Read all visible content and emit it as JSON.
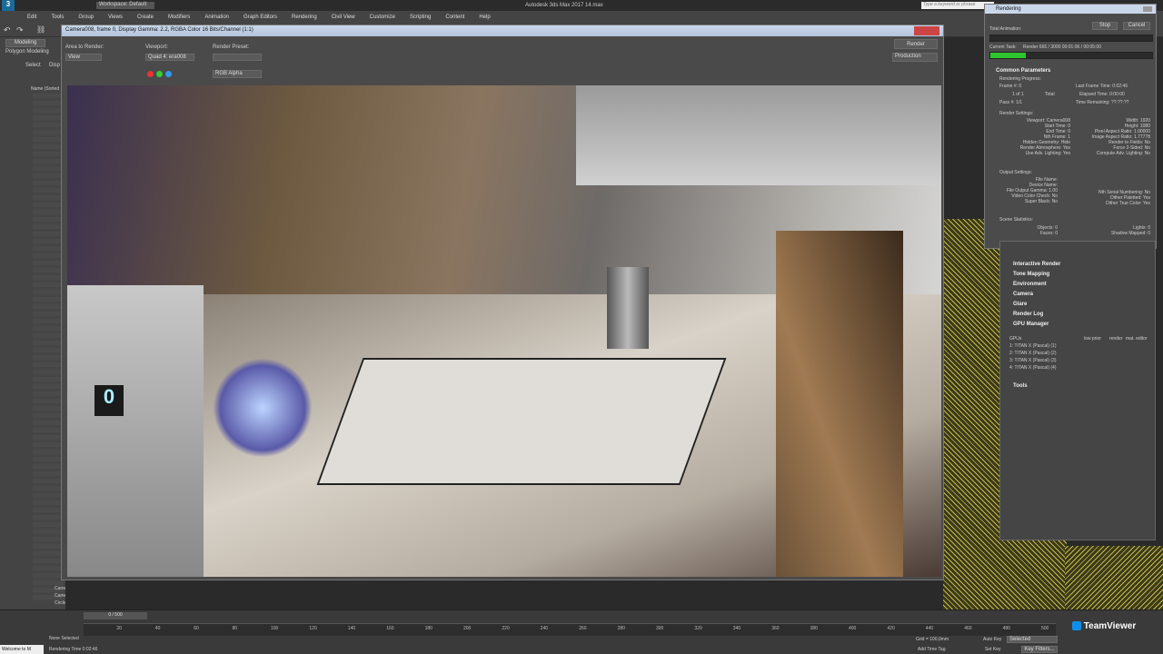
{
  "app": {
    "logo": "3",
    "workspace": "Workspace: Default",
    "title": "Autodesk 3ds Max 2017   14.max",
    "search_placeholder": "Type a keyword or phrase"
  },
  "menu": [
    "Edit",
    "Tools",
    "Group",
    "Views",
    "Create",
    "Modifiers",
    "Animation",
    "Graph Editors",
    "Rendering",
    "Civil View",
    "Customize",
    "Scripting",
    "Content",
    "Help"
  ],
  "ribbon": {
    "tab1": "Modeling",
    "tab2": "Polygon Modeling",
    "select": "Select",
    "disp": "Disp"
  },
  "scene_header": "Name (Sorted",
  "scene_items": [
    "Camer",
    "Camer",
    "Circle"
  ],
  "frame_window": {
    "title": "Camera008, frame 0, Display Gamma: 2.2, RGBA Color 16 Bits/Channel (1:1)",
    "area_label": "Area to Render:",
    "area_value": "View",
    "viewport_label": "Viewport:",
    "viewport_value": "Quad 4: era008",
    "preset_label": "Render Preset:",
    "preset_value": "",
    "render_btn": "Render",
    "production": "Production",
    "channel": "RGB Alpha",
    "display_digit": "0"
  },
  "progress": {
    "title": "Rendering",
    "stop": "Stop",
    "cancel": "Cancel",
    "total_animation": "Total Animation:",
    "current_task": "Current Task:",
    "current_task_value": "Render  665 / 3000  00:01:06 / 00:05:00",
    "current_fraction": 0.2216,
    "common": "Common Parameters",
    "rendering_progress": "Rendering Progress:",
    "frame": "Frame #: 0",
    "one_of": "1 of 1",
    "total": "Total",
    "pass": "Pass #: 1/1",
    "last_frame": "Last Frame Time: 0:02:46",
    "elapsed": "Elapsed Time: 0:00:00",
    "remaining": "Time Remaining: ??:??:??",
    "render_settings": "Render Settings:",
    "left_settings": [
      "Viewport: Camera008",
      "Start Time: 0",
      "End Time: 0",
      "Nth Frame: 1",
      "Hidden Geometry: Hide",
      "Render Atmosphere: Yes",
      "Use Adv. Lighting: Yes"
    ],
    "right_settings": [
      "Width: 1920",
      "Height: 1080",
      "Pixel Aspect Ratio: 1.00000",
      "Image Aspect Ratio: 1.77778",
      "Render to Fields: No",
      "Force 2-Sided: No",
      "Compute Adv. Lighting: No"
    ],
    "output_settings": "Output Settings:",
    "output_left": [
      "File Name:",
      "Device Name:",
      "File Output Gamma: 1.00",
      "Video Color Check: No",
      "Super Black: No"
    ],
    "output_right": [
      "",
      "",
      "Nth Serial Numbering: No",
      "Dither Paletted: Yes",
      "Dither True Color: Yes"
    ],
    "scene_stats": "Scene Statistics:",
    "stats_left": [
      "Objects: 0",
      "Faces: 0"
    ],
    "stats_right": [
      "Lights: 0",
      "Shadow Mapped: 0"
    ]
  },
  "rollouts": [
    "Interactive Render",
    "Tone Mapping",
    "Environment",
    "Camera",
    "Glare",
    "Render Log",
    "GPU Manager"
  ],
  "gpu": {
    "label": "GPUs",
    "col1": "low prior",
    "col2": "render",
    "col3": "mat. editor",
    "rows": [
      "1: TITAN X (Pascal) (1)",
      "2: TITAN X (Pascal) (2)",
      "3: TITAN X (Pascal) (3)",
      "4: TITAN X (Pascal) (4)"
    ]
  },
  "tools": "Tools",
  "timeline": {
    "frame": "0 / 500",
    "ticks": [
      "20",
      "40",
      "60",
      "80",
      "100",
      "120",
      "140",
      "160",
      "180",
      "200",
      "220",
      "240",
      "260",
      "280",
      "300",
      "320",
      "340",
      "360",
      "380",
      "400",
      "420",
      "440",
      "460",
      "480",
      "500"
    ],
    "welcome": "Welcome to M",
    "status1": "None Selected",
    "status2": "Rendering Time 0:02:46",
    "grid": "Grid = 100,0mm",
    "add_time_tag": "Add Time Tag",
    "auto_key": "Auto Key",
    "selected": "Selected",
    "set_key": "Set Key",
    "key_filters": "Key Filters...",
    "teamviewer": "TeamViewer"
  },
  "colors": {
    "accent": "#2ec62e",
    "title_bg": "#c9d7ea"
  }
}
